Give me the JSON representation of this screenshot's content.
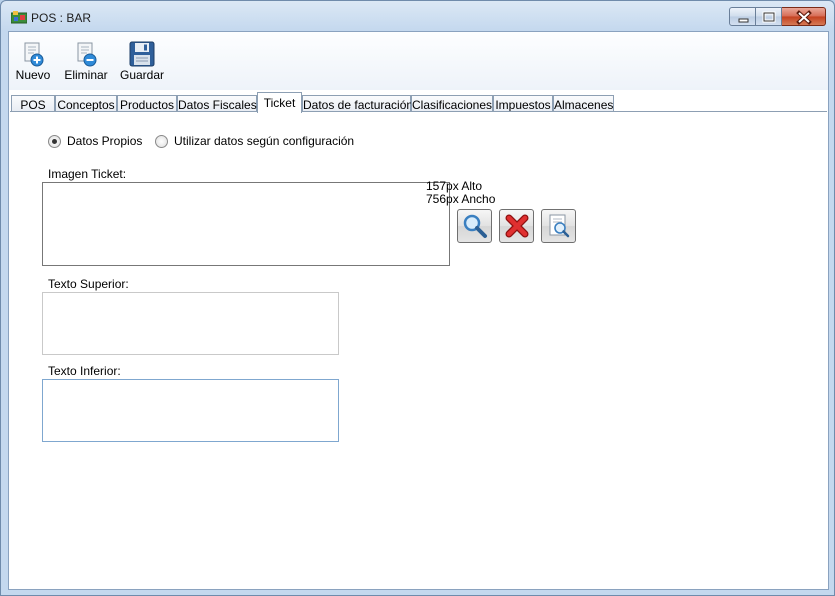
{
  "window": {
    "title": "POS : BAR"
  },
  "toolbar": {
    "nuevo": "Nuevo",
    "eliminar": "Eliminar",
    "guardar": "Guardar"
  },
  "tabs": [
    {
      "label": "POS",
      "active": false
    },
    {
      "label": "Conceptos",
      "active": false
    },
    {
      "label": "Productos",
      "active": false
    },
    {
      "label": "Datos Fiscales",
      "active": false
    },
    {
      "label": "Ticket",
      "active": true
    },
    {
      "label": "Datos de facturación",
      "active": false
    },
    {
      "label": "Clasificaciones",
      "active": false
    },
    {
      "label": "Impuestos",
      "active": false
    },
    {
      "label": "Almacenes",
      "active": false
    }
  ],
  "ticket": {
    "radio_own": "Datos Propios",
    "radio_own_checked": true,
    "radio_config": "Utilizar datos según configuración",
    "radio_config_checked": false,
    "imagen_label": "Imagen Ticket:",
    "height_text": "157px Alto",
    "width_text": "756px Ancho",
    "texto_superior_label": "Texto Superior:",
    "texto_superior_value": "",
    "texto_inferior_label": "Texto Inferior:",
    "texto_inferior_value": ""
  },
  "icons": {
    "app": "app-icon",
    "nuevo": "new-document-icon",
    "eliminar": "delete-document-icon",
    "guardar": "floppy-disk-icon",
    "browse": "magnifier-icon",
    "remove": "red-x-icon",
    "preview": "page-preview-icon"
  }
}
